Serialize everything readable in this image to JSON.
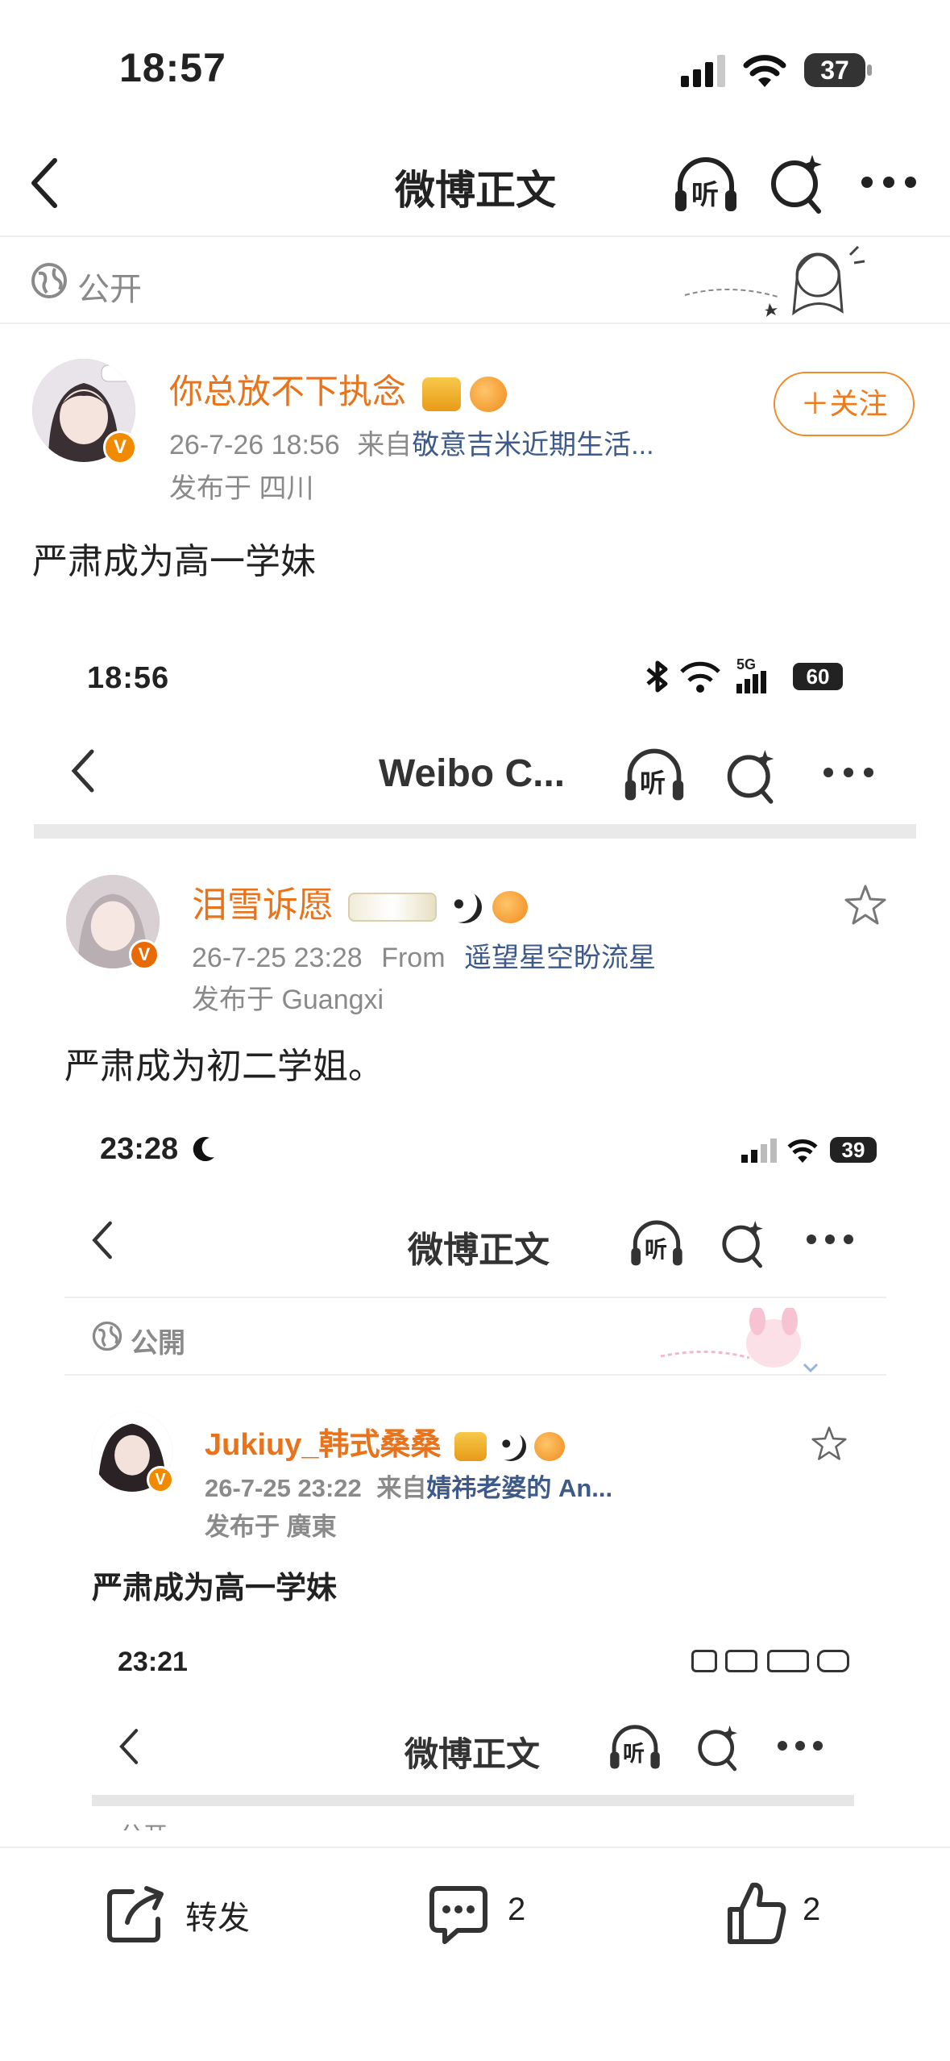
{
  "status_bar": {
    "time": "18:57",
    "battery": "37"
  },
  "nav": {
    "title": "微博正文",
    "listen": "听"
  },
  "visibility": {
    "label": "公开"
  },
  "post": {
    "author": "你总放不下执念",
    "meta_date": "26-7-26 18:56",
    "meta_from": "来自",
    "meta_source": "敬意吉米近期生活...",
    "location": "发布于 四川",
    "follow_label": "＋关注",
    "verified_mark": "V",
    "text": "严肃成为高一学妹"
  },
  "nested1": {
    "time": "18:56",
    "battery": "60",
    "net": "5G",
    "title": "Weibo C...",
    "listen": "听",
    "author": "泪雪诉愿",
    "date": "26-7-25 23:28",
    "from": "From",
    "source": "遥望星空盼流星",
    "location": "发布于 Guangxi",
    "verified_mark": "V",
    "text": "严肃成为初二学姐。"
  },
  "nested2": {
    "time": "23:28",
    "battery": "39",
    "title": "微博正文",
    "listen": "听",
    "visibility": "公開",
    "author": "Jukiuy_韩式桑桑",
    "date": "26-7-25 23:22",
    "from": "来自",
    "source": "婧祎老婆的 An...",
    "location": "发布于 廣東",
    "verified_mark": "V",
    "text": "严肃成为高一学妹"
  },
  "nested3": {
    "time": "23:21",
    "title": "微博正文",
    "listen": "听",
    "visibility": "公开"
  },
  "bottom_bar": {
    "repost_label": "转发",
    "comment_count": "2",
    "like_count": "2"
  },
  "colors": {
    "accent": "#e8731a",
    "link": "#3d5a8a",
    "divider": "#eeeeee"
  }
}
